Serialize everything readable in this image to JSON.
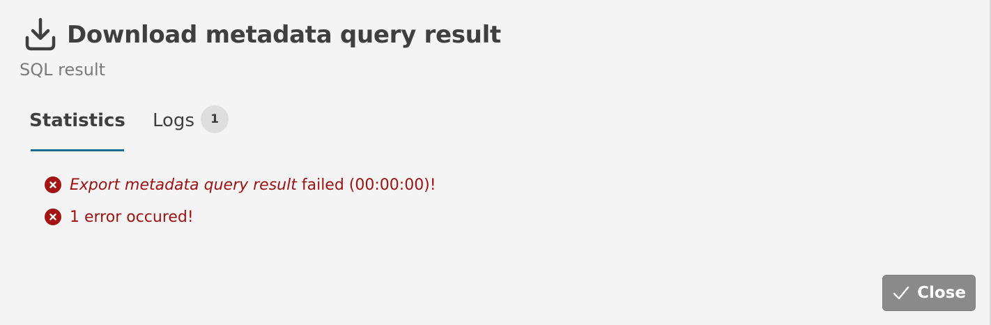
{
  "dialog": {
    "title": "Download metadata query result",
    "subtitle": "SQL result",
    "icon": "download-icon"
  },
  "tabs": [
    {
      "label": "Statistics",
      "active": true
    },
    {
      "label": "Logs",
      "badge": "1",
      "active": false
    }
  ],
  "messages": [
    {
      "icon": "error-icon",
      "italic": "Export metadata query result",
      "text": " failed (00:00:00)!"
    },
    {
      "icon": "error-icon",
      "italic": "",
      "text": "1 error occured!"
    }
  ],
  "footer": {
    "close_label": "Close",
    "close_icon": "check-icon"
  },
  "colors": {
    "background": "#f4f4f4",
    "tab_underline": "#1f6b91",
    "error": "#9c1111",
    "button": "#8a8a8a"
  }
}
